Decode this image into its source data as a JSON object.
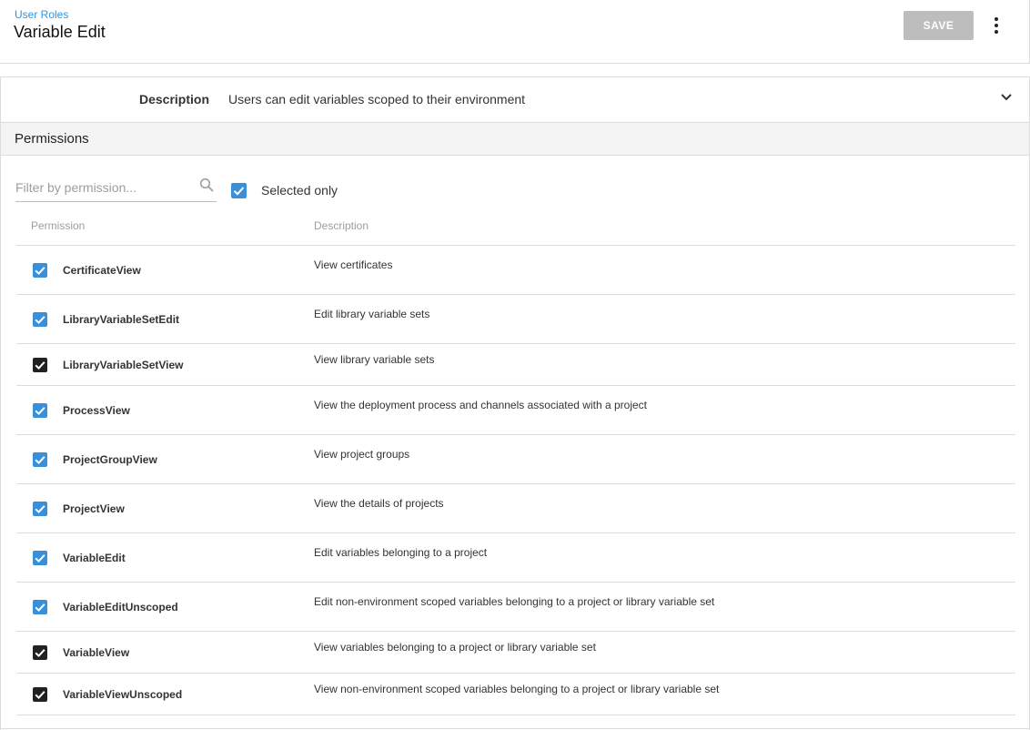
{
  "header": {
    "breadcrumb": "User Roles",
    "title": "Variable Edit",
    "save_label": "SAVE"
  },
  "description": {
    "label": "Description",
    "value": "Users can edit variables scoped to their environment"
  },
  "permissions": {
    "section_title": "Permissions",
    "filter_placeholder": "Filter by permission...",
    "selected_only_label": "Selected only",
    "selected_only_checked": true,
    "columns": [
      "Permission",
      "Description"
    ],
    "rows": [
      {
        "name": "CertificateView",
        "description": "View certificates",
        "style": "blue"
      },
      {
        "name": "LibraryVariableSetEdit",
        "description": "Edit library variable sets",
        "style": "blue"
      },
      {
        "name": "LibraryVariableSetView",
        "description": "View library variable sets",
        "style": "dark"
      },
      {
        "name": "ProcessView",
        "description": "View the deployment process and channels associated with a project",
        "style": "blue"
      },
      {
        "name": "ProjectGroupView",
        "description": "View project groups",
        "style": "blue"
      },
      {
        "name": "ProjectView",
        "description": "View the details of projects",
        "style": "blue"
      },
      {
        "name": "VariableEdit",
        "description": "Edit variables belonging to a project",
        "style": "blue"
      },
      {
        "name": "VariableEditUnscoped",
        "description": "Edit non-environment scoped variables belonging to a project or library variable set",
        "style": "blue"
      },
      {
        "name": "VariableView",
        "description": "View variables belonging to a project or library variable set",
        "style": "dark"
      },
      {
        "name": "VariableViewUnscoped",
        "description": "View non-environment scoped variables belonging to a project or library variable set",
        "style": "dark"
      }
    ]
  },
  "colors": {
    "accent": "#2f93e0",
    "checkbox_blue": "#3a8fd9",
    "checkbox_dark": "#212121",
    "save_disabled": "#bdbdbd"
  },
  "icons": {
    "search": "search-icon",
    "more": "more-vert-icon",
    "chevron": "chevron-down-icon",
    "checkbox": "checkbox-checked-icon"
  }
}
